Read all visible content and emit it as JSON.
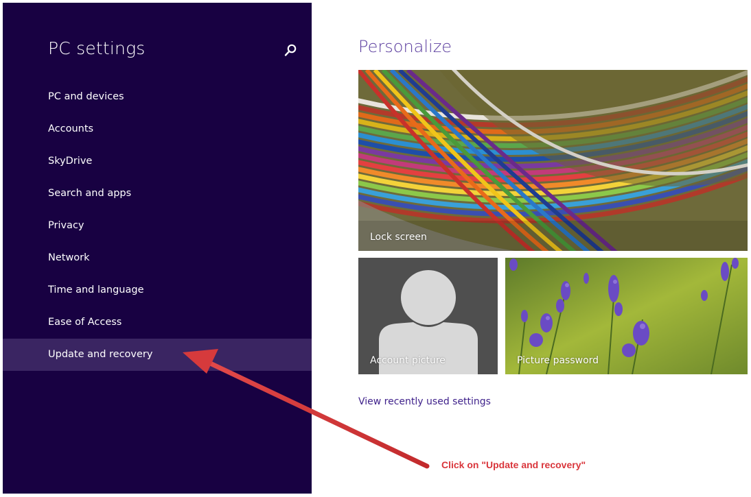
{
  "sidebar": {
    "title": "PC settings",
    "search_icon": "search-icon",
    "items": [
      {
        "label": "PC and devices"
      },
      {
        "label": "Accounts"
      },
      {
        "label": "SkyDrive"
      },
      {
        "label": "Search and apps"
      },
      {
        "label": "Privacy"
      },
      {
        "label": "Network"
      },
      {
        "label": "Time and language"
      },
      {
        "label": "Ease of Access"
      },
      {
        "label": "Update and recovery",
        "selected": true
      }
    ]
  },
  "main": {
    "title": "Personalize",
    "tiles": {
      "lock_screen": "Lock screen",
      "account_picture": "Account picture",
      "picture_password": "Picture password"
    },
    "recent_link": "View recently used settings"
  },
  "annotation": {
    "text": "Click on \"Update and recovery\"",
    "color": "#d9353b"
  },
  "colors": {
    "sidebar_bg": "#180142",
    "sidebar_selected": "#3a2562",
    "accent_text": "#5a3c9e",
    "link": "#3d1f8a"
  }
}
